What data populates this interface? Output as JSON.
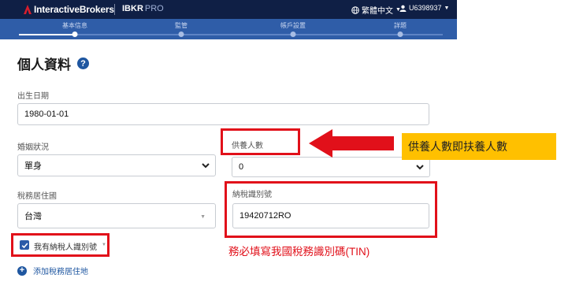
{
  "header": {
    "brand": "InteractiveBrokers",
    "product": "IBKR",
    "product_suffix": "PRO",
    "language": "繁體中文",
    "username": "U6398937"
  },
  "steps": [
    {
      "label": "基本信息",
      "state": "current"
    },
    {
      "label": "監管",
      "state": "pending"
    },
    {
      "label": "帳戶設置",
      "state": "pending"
    },
    {
      "label": "詳題",
      "state": "pending"
    }
  ],
  "page": {
    "title": "個人資料"
  },
  "form": {
    "dob_label": "出生日期",
    "dob_value": "1980-01-01",
    "marital_label": "婚姻狀況",
    "marital_value": "單身",
    "dependents_label": "供養人數",
    "dependents_value": "0",
    "tax_country_label": "稅務居住國",
    "tax_country_value": "台灣",
    "tin_label": "納稅識別號",
    "tin_value": "19420712RO",
    "has_tin_label": "我有納稅人識別號",
    "has_tin_checked": true,
    "add_tax_residence": "添加稅務居住地"
  },
  "annotations": {
    "callout_text": "供養人數即扶養人數",
    "tin_note": "務必填寫我國稅務識別碼(TIN)",
    "highlight_color": "#e1101a",
    "callout_color": "#ffc000"
  }
}
